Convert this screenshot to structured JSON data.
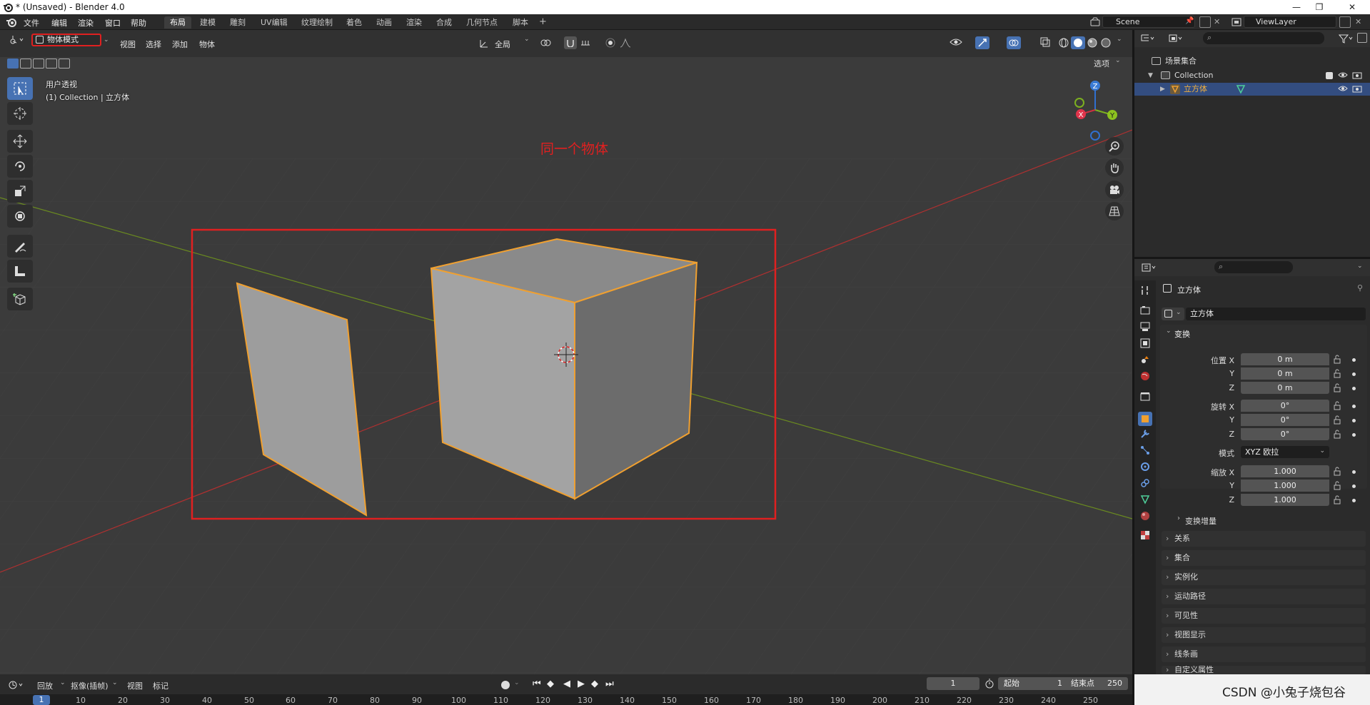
{
  "window": {
    "title": "* (Unsaved) - Blender 4.0"
  },
  "menu": [
    "文件",
    "编辑",
    "渲染",
    "窗口",
    "帮助"
  ],
  "workspaces": [
    "布局",
    "建模",
    "雕刻",
    "UV编辑",
    "纹理绘制",
    "着色",
    "动画",
    "渲染",
    "合成",
    "几何节点",
    "脚本"
  ],
  "active_workspace": "布局",
  "scene": {
    "name": "Scene",
    "view_layer": "ViewLayer"
  },
  "viewport": {
    "mode": "物体模式",
    "menus": [
      "视图",
      "选择",
      "添加",
      "物体"
    ],
    "orientation": "全局",
    "options_label": "选项",
    "view_name": "用户透视",
    "collection_info": "(1) Collection | 立方体",
    "annotation": "同一个物体",
    "gizmo_axes": [
      "X",
      "Y",
      "Z"
    ]
  },
  "outliner": {
    "root": "场景集合",
    "collection": "Collection",
    "object": "立方体"
  },
  "properties": {
    "object_title": "立方体",
    "object_name": "立方体",
    "transform_section": "变换",
    "location_label": "位置 X",
    "rotation_label": "旋转 X",
    "scale_label": "缩放 X",
    "mode_label": "模式",
    "y": "Y",
    "z": "Z",
    "location": [
      "0 m",
      "0 m",
      "0 m"
    ],
    "rotation": [
      "0°",
      "0°",
      "0°"
    ],
    "rotation_mode": "XYZ 欧拉",
    "scale": [
      "1.000",
      "1.000",
      "1.000"
    ],
    "delta_transform": "变换增量",
    "panels": [
      "关系",
      "集合",
      "实例化",
      "运动路径",
      "可见性",
      "视图显示",
      "线条画",
      "自定义属性"
    ]
  },
  "timeline": {
    "menus": [
      "回放",
      "抠像(插帧)",
      "视图",
      "标记"
    ],
    "current_frame": "1",
    "start_label": "起始",
    "start": "1",
    "end_label": "结束点",
    "end": "250",
    "ruler": [
      "1",
      "10",
      "20",
      "30",
      "40",
      "50",
      "60",
      "70",
      "80",
      "90",
      "100",
      "110",
      "120",
      "130",
      "140",
      "150",
      "160",
      "170",
      "180",
      "190",
      "200",
      "210",
      "220",
      "230",
      "240",
      "250"
    ]
  },
  "watermark": "CSDN @小兔子烧包谷",
  "colors": {
    "accent": "#4772b3",
    "selection_outline": "#f0a030",
    "annotation_red": "#e02020"
  }
}
